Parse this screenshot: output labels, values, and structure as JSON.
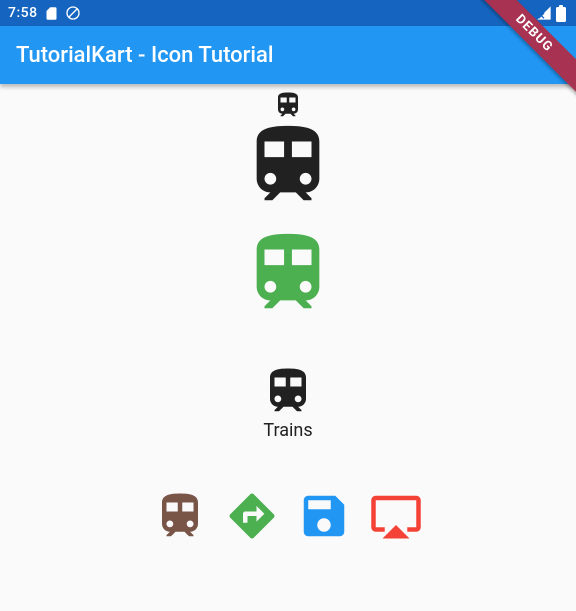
{
  "status": {
    "time": "7:58"
  },
  "appbar": {
    "title": "TutorialKart - Icon Tutorial"
  },
  "debug": {
    "label": "DEBUG"
  },
  "icons": {
    "small_train": {
      "color": "#212121",
      "size": 30
    },
    "medium_train": {
      "color": "#212121",
      "size": 94
    },
    "green_train": {
      "color": "#4caf50",
      "size": 94
    },
    "labeled_train": {
      "color": "#212121",
      "size": 54,
      "caption": "Trains"
    },
    "row": {
      "brown_train": {
        "color": "#795548",
        "size": 54
      },
      "green_directions": {
        "color": "#4caf50",
        "size": 54
      },
      "blue_save": {
        "color": "#2196f3",
        "size": 54
      },
      "red_airplay": {
        "color": "#f44336",
        "size": 54
      }
    }
  }
}
